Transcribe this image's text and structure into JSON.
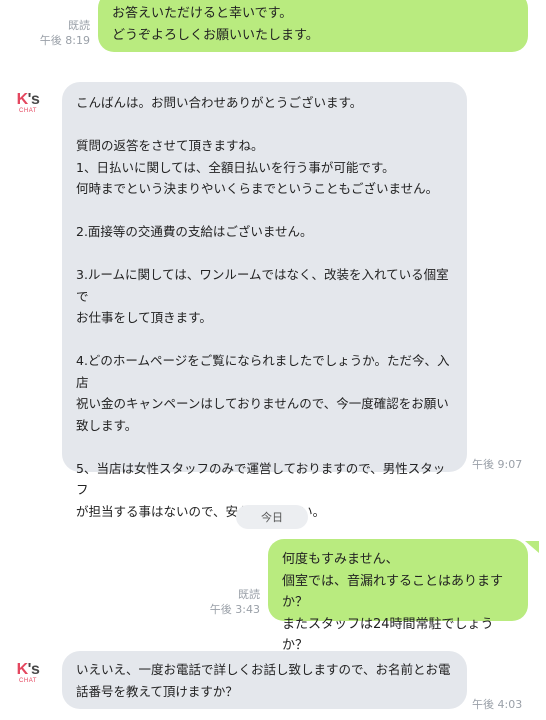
{
  "messages": {
    "m1": {
      "text": "お答えいただけると幸いです。\nどうぞよろしくお願いいたします。",
      "read_label": "既読",
      "time": "午後 8:19"
    },
    "m2": {
      "text": "こんばんは。お問い合わせありがとうございます。\n\n質問の返答をさせて頂きますね。\n1、日払いに関しては、全額日払いを行う事が可能です。\n何時までという決まりやいくらまでということもございません。\n\n2.面接等の交通費の支給はございません。\n\n3.ルームに関しては、ワンルームではなく、改装を入れている個室で\nお仕事をして頂きます。\n\n4.どのホームページをご覧になられましたでしょうか。ただ今、入店\n祝い金のキャンペーンはしておりませんので、今一度確認をお願い\n致します。\n\n5、当店は女性スタッフのみで運営しておりますので、男性スタッフ\nが担当する事はないので、安心して下さい。",
      "time": "午後 9:07"
    },
    "date_divider": "今日",
    "m3": {
      "text": "何度もすみません、\n個室では、音漏れすることはありますか？\nまたスタッフは24時間常駐でしょうか？",
      "read_label": "既読",
      "time": "午後 3:43"
    },
    "m4": {
      "text": "いえいえ、一度お電話で詳しくお話し致しますので、お名前とお電\n話番号を教えて頂けますか？",
      "time": "午後 4:03"
    }
  },
  "avatar": {
    "logo_k": "K",
    "logo_s": "'s",
    "logo_sub": "CHAT"
  },
  "colors": {
    "outgoing_bubble": "#b9eb7f",
    "incoming_bubble": "#e4e7ec",
    "meta_text": "#9aa0a8",
    "logo_accent": "#e4475f"
  }
}
